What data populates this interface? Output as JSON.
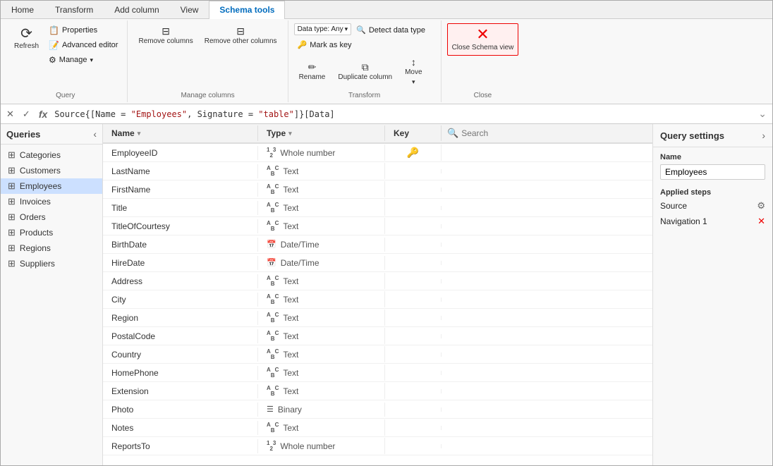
{
  "app": {
    "title": "Power Query Editor"
  },
  "ribbon": {
    "tabs": [
      "Home",
      "Transform",
      "Add column",
      "View",
      "Schema tools"
    ],
    "active_tab": "Schema tools",
    "groups": {
      "query": {
        "label": "Query",
        "refresh_label": "Refresh",
        "properties_label": "Properties",
        "advanced_editor_label": "Advanced editor",
        "manage_label": "Manage"
      },
      "manage_columns": {
        "label": "Manage columns",
        "remove_columns": "Remove columns",
        "remove_other_columns": "Remove other columns"
      },
      "transform": {
        "label": "Transform",
        "data_type_label": "Data type: Any",
        "detect_data_type": "Detect data type",
        "mark_as_key": "Mark as key",
        "rename": "Rename",
        "duplicate_column": "Duplicate column",
        "move": "Move"
      },
      "close": {
        "label": "Close",
        "close_schema_view": "Close Schema view"
      }
    }
  },
  "formula_bar": {
    "formula": "Source{[Name = \"Employees\", Signature = \"table\"]}[Data]"
  },
  "sidebar": {
    "title": "Queries",
    "items": [
      {
        "label": "Categories",
        "icon": "table"
      },
      {
        "label": "Customers",
        "icon": "table"
      },
      {
        "label": "Employees",
        "icon": "table",
        "active": true
      },
      {
        "label": "Invoices",
        "icon": "table"
      },
      {
        "label": "Orders",
        "icon": "table"
      },
      {
        "label": "Products",
        "icon": "table"
      },
      {
        "label": "Regions",
        "icon": "table"
      },
      {
        "label": "Suppliers",
        "icon": "table"
      }
    ]
  },
  "table": {
    "columns": [
      "Name",
      "Type",
      "Key"
    ],
    "search_placeholder": "Search",
    "rows": [
      {
        "name": "EmployeeID",
        "type": "Whole number",
        "type_icon": "123",
        "key": true
      },
      {
        "name": "LastName",
        "type": "Text",
        "type_icon": "ABC",
        "key": false
      },
      {
        "name": "FirstName",
        "type": "Text",
        "type_icon": "ABC",
        "key": false
      },
      {
        "name": "Title",
        "type": "Text",
        "type_icon": "ABC",
        "key": false
      },
      {
        "name": "TitleOfCourtesy",
        "type": "Text",
        "type_icon": "ABC",
        "key": false
      },
      {
        "name": "BirthDate",
        "type": "Date/Time",
        "type_icon": "DT",
        "key": false
      },
      {
        "name": "HireDate",
        "type": "Date/Time",
        "type_icon": "DT",
        "key": false
      },
      {
        "name": "Address",
        "type": "Text",
        "type_icon": "ABC",
        "key": false
      },
      {
        "name": "City",
        "type": "Text",
        "type_icon": "ABC",
        "key": false
      },
      {
        "name": "Region",
        "type": "Text",
        "type_icon": "ABC",
        "key": false
      },
      {
        "name": "PostalCode",
        "type": "Text",
        "type_icon": "ABC",
        "key": false
      },
      {
        "name": "Country",
        "type": "Text",
        "type_icon": "ABC",
        "key": false
      },
      {
        "name": "HomePhone",
        "type": "Text",
        "type_icon": "ABC",
        "key": false
      },
      {
        "name": "Extension",
        "type": "Text",
        "type_icon": "ABC",
        "key": false
      },
      {
        "name": "Photo",
        "type": "Binary",
        "type_icon": "BIN",
        "key": false
      },
      {
        "name": "Notes",
        "type": "Text",
        "type_icon": "ABC",
        "key": false
      },
      {
        "name": "ReportsTo",
        "type": "Whole number",
        "type_icon": "123",
        "key": false
      }
    ]
  },
  "settings": {
    "title": "Query settings",
    "name_label": "Name",
    "name_value": "Employees",
    "applied_steps_label": "Applied steps",
    "steps": [
      {
        "name": "Source",
        "has_gear": true,
        "deletable": false
      },
      {
        "name": "Navigation 1",
        "has_gear": false,
        "deletable": true
      }
    ]
  }
}
